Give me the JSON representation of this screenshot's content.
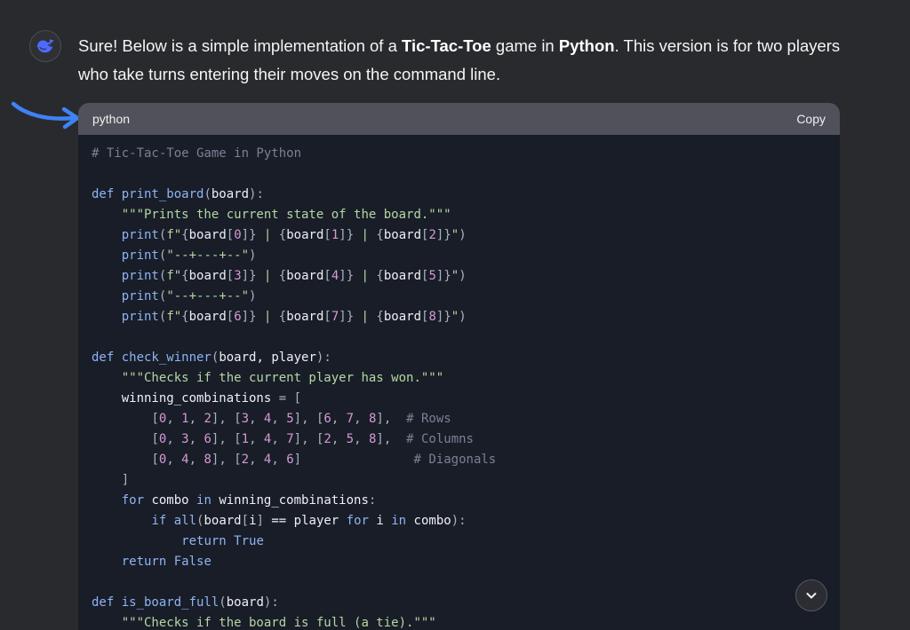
{
  "message": {
    "intro_segments": [
      {
        "text": "Sure! Below is a simple implementation of a ",
        "bold": false
      },
      {
        "text": "Tic-Tac-Toe",
        "bold": true
      },
      {
        "text": " game in ",
        "bold": false
      },
      {
        "text": "Python",
        "bold": true
      },
      {
        "text": ". This version is for two players who take turns entering their moves on the command line.",
        "bold": false
      }
    ]
  },
  "code_block": {
    "language": "python",
    "copy_label": "Copy",
    "lines": [
      [
        [
          "comment",
          "# Tic-Tac-Toe Game in Python"
        ]
      ],
      [],
      [
        [
          "keyword",
          "def "
        ],
        [
          "function",
          "print_board"
        ],
        [
          "punct",
          "("
        ],
        [
          "text",
          "board"
        ],
        [
          "punct",
          "):"
        ]
      ],
      [
        [
          "text",
          "    "
        ],
        [
          "string",
          "\"\"\"Prints the current state of the board.\"\"\""
        ]
      ],
      [
        [
          "text",
          "    "
        ],
        [
          "builtin",
          "print"
        ],
        [
          "punct",
          "("
        ],
        [
          "string",
          "f\""
        ],
        [
          "punct",
          "{"
        ],
        [
          "text",
          "board"
        ],
        [
          "punct",
          "["
        ],
        [
          "number",
          "0"
        ],
        [
          "punct",
          "]}"
        ],
        [
          "string",
          " | "
        ],
        [
          "punct",
          "{"
        ],
        [
          "text",
          "board"
        ],
        [
          "punct",
          "["
        ],
        [
          "number",
          "1"
        ],
        [
          "punct",
          "]}"
        ],
        [
          "string",
          " | "
        ],
        [
          "punct",
          "{"
        ],
        [
          "text",
          "board"
        ],
        [
          "punct",
          "["
        ],
        [
          "number",
          "2"
        ],
        [
          "punct",
          "]}"
        ],
        [
          "string",
          "\""
        ],
        [
          "punct",
          ")"
        ]
      ],
      [
        [
          "text",
          "    "
        ],
        [
          "builtin",
          "print"
        ],
        [
          "punct",
          "("
        ],
        [
          "string",
          "\"--+---+--\""
        ],
        [
          "punct",
          ")"
        ]
      ],
      [
        [
          "text",
          "    "
        ],
        [
          "builtin",
          "print"
        ],
        [
          "punct",
          "("
        ],
        [
          "string",
          "f\""
        ],
        [
          "punct",
          "{"
        ],
        [
          "text",
          "board"
        ],
        [
          "punct",
          "["
        ],
        [
          "number",
          "3"
        ],
        [
          "punct",
          "]}"
        ],
        [
          "string",
          " | "
        ],
        [
          "punct",
          "{"
        ],
        [
          "text",
          "board"
        ],
        [
          "punct",
          "["
        ],
        [
          "number",
          "4"
        ],
        [
          "punct",
          "]}"
        ],
        [
          "string",
          " | "
        ],
        [
          "punct",
          "{"
        ],
        [
          "text",
          "board"
        ],
        [
          "punct",
          "["
        ],
        [
          "number",
          "5"
        ],
        [
          "punct",
          "]}"
        ],
        [
          "string",
          "\""
        ],
        [
          "punct",
          ")"
        ]
      ],
      [
        [
          "text",
          "    "
        ],
        [
          "builtin",
          "print"
        ],
        [
          "punct",
          "("
        ],
        [
          "string",
          "\"--+---+--\""
        ],
        [
          "punct",
          ")"
        ]
      ],
      [
        [
          "text",
          "    "
        ],
        [
          "builtin",
          "print"
        ],
        [
          "punct",
          "("
        ],
        [
          "string",
          "f\""
        ],
        [
          "punct",
          "{"
        ],
        [
          "text",
          "board"
        ],
        [
          "punct",
          "["
        ],
        [
          "number",
          "6"
        ],
        [
          "punct",
          "]}"
        ],
        [
          "string",
          " | "
        ],
        [
          "punct",
          "{"
        ],
        [
          "text",
          "board"
        ],
        [
          "punct",
          "["
        ],
        [
          "number",
          "7"
        ],
        [
          "punct",
          "]}"
        ],
        [
          "string",
          " | "
        ],
        [
          "punct",
          "{"
        ],
        [
          "text",
          "board"
        ],
        [
          "punct",
          "["
        ],
        [
          "number",
          "8"
        ],
        [
          "punct",
          "]}"
        ],
        [
          "string",
          "\""
        ],
        [
          "punct",
          ")"
        ]
      ],
      [],
      [
        [
          "keyword",
          "def "
        ],
        [
          "function",
          "check_winner"
        ],
        [
          "punct",
          "("
        ],
        [
          "text",
          "board, player"
        ],
        [
          "punct",
          "):"
        ]
      ],
      [
        [
          "text",
          "    "
        ],
        [
          "string",
          "\"\"\"Checks if the current player has won.\"\"\""
        ]
      ],
      [
        [
          "text",
          "    winning_combinations "
        ],
        [
          "punct",
          "= ["
        ]
      ],
      [
        [
          "text",
          "        "
        ],
        [
          "punct",
          "["
        ],
        [
          "number",
          "0"
        ],
        [
          "punct",
          ", "
        ],
        [
          "number",
          "1"
        ],
        [
          "punct",
          ", "
        ],
        [
          "number",
          "2"
        ],
        [
          "punct",
          "], ["
        ],
        [
          "number",
          "3"
        ],
        [
          "punct",
          ", "
        ],
        [
          "number",
          "4"
        ],
        [
          "punct",
          ", "
        ],
        [
          "number",
          "5"
        ],
        [
          "punct",
          "], ["
        ],
        [
          "number",
          "6"
        ],
        [
          "punct",
          ", "
        ],
        [
          "number",
          "7"
        ],
        [
          "punct",
          ", "
        ],
        [
          "number",
          "8"
        ],
        [
          "punct",
          "],  "
        ],
        [
          "comment",
          "# Rows"
        ]
      ],
      [
        [
          "text",
          "        "
        ],
        [
          "punct",
          "["
        ],
        [
          "number",
          "0"
        ],
        [
          "punct",
          ", "
        ],
        [
          "number",
          "3"
        ],
        [
          "punct",
          ", "
        ],
        [
          "number",
          "6"
        ],
        [
          "punct",
          "], ["
        ],
        [
          "number",
          "1"
        ],
        [
          "punct",
          ", "
        ],
        [
          "number",
          "4"
        ],
        [
          "punct",
          ", "
        ],
        [
          "number",
          "7"
        ],
        [
          "punct",
          "], ["
        ],
        [
          "number",
          "2"
        ],
        [
          "punct",
          ", "
        ],
        [
          "number",
          "5"
        ],
        [
          "punct",
          ", "
        ],
        [
          "number",
          "8"
        ],
        [
          "punct",
          "],  "
        ],
        [
          "comment",
          "# Columns"
        ]
      ],
      [
        [
          "text",
          "        "
        ],
        [
          "punct",
          "["
        ],
        [
          "number",
          "0"
        ],
        [
          "punct",
          ", "
        ],
        [
          "number",
          "4"
        ],
        [
          "punct",
          ", "
        ],
        [
          "number",
          "8"
        ],
        [
          "punct",
          "], ["
        ],
        [
          "number",
          "2"
        ],
        [
          "punct",
          ", "
        ],
        [
          "number",
          "4"
        ],
        [
          "punct",
          ", "
        ],
        [
          "number",
          "6"
        ],
        [
          "punct",
          "]               "
        ],
        [
          "comment",
          "# Diagonals"
        ]
      ],
      [
        [
          "text",
          "    "
        ],
        [
          "punct",
          "]"
        ]
      ],
      [
        [
          "text",
          "    "
        ],
        [
          "keyword",
          "for "
        ],
        [
          "text",
          "combo "
        ],
        [
          "keyword",
          "in "
        ],
        [
          "text",
          "winning_combinations"
        ],
        [
          "punct",
          ":"
        ]
      ],
      [
        [
          "text",
          "        "
        ],
        [
          "keyword",
          "if "
        ],
        [
          "builtin",
          "all"
        ],
        [
          "punct",
          "("
        ],
        [
          "text",
          "board"
        ],
        [
          "punct",
          "["
        ],
        [
          "text",
          "i"
        ],
        [
          "punct",
          "]"
        ],
        [
          "text",
          " == player "
        ],
        [
          "keyword",
          "for "
        ],
        [
          "text",
          "i "
        ],
        [
          "keyword",
          "in "
        ],
        [
          "text",
          "combo"
        ],
        [
          "punct",
          "):"
        ]
      ],
      [
        [
          "text",
          "            "
        ],
        [
          "keyword",
          "return "
        ],
        [
          "keyword",
          "True"
        ]
      ],
      [
        [
          "text",
          "    "
        ],
        [
          "keyword",
          "return "
        ],
        [
          "keyword",
          "False"
        ]
      ],
      [],
      [
        [
          "keyword",
          "def "
        ],
        [
          "function",
          "is_board_full"
        ],
        [
          "punct",
          "("
        ],
        [
          "text",
          "board"
        ],
        [
          "punct",
          "):"
        ]
      ],
      [
        [
          "text",
          "    "
        ],
        [
          "string",
          "\"\"\"Checks if the board is full (a tie).\"\"\""
        ]
      ]
    ]
  },
  "icons": {
    "avatar": "whale-logo-icon",
    "scroll_down": "chevron-down-icon",
    "annotation": "curved-arrow-icon"
  },
  "colors": {
    "page_background": "#292a2d",
    "code_background": "#181d28",
    "header_background": "#50515a",
    "logo_blue": "#4d6bfe",
    "annotation_blue": "#3f82f5"
  }
}
